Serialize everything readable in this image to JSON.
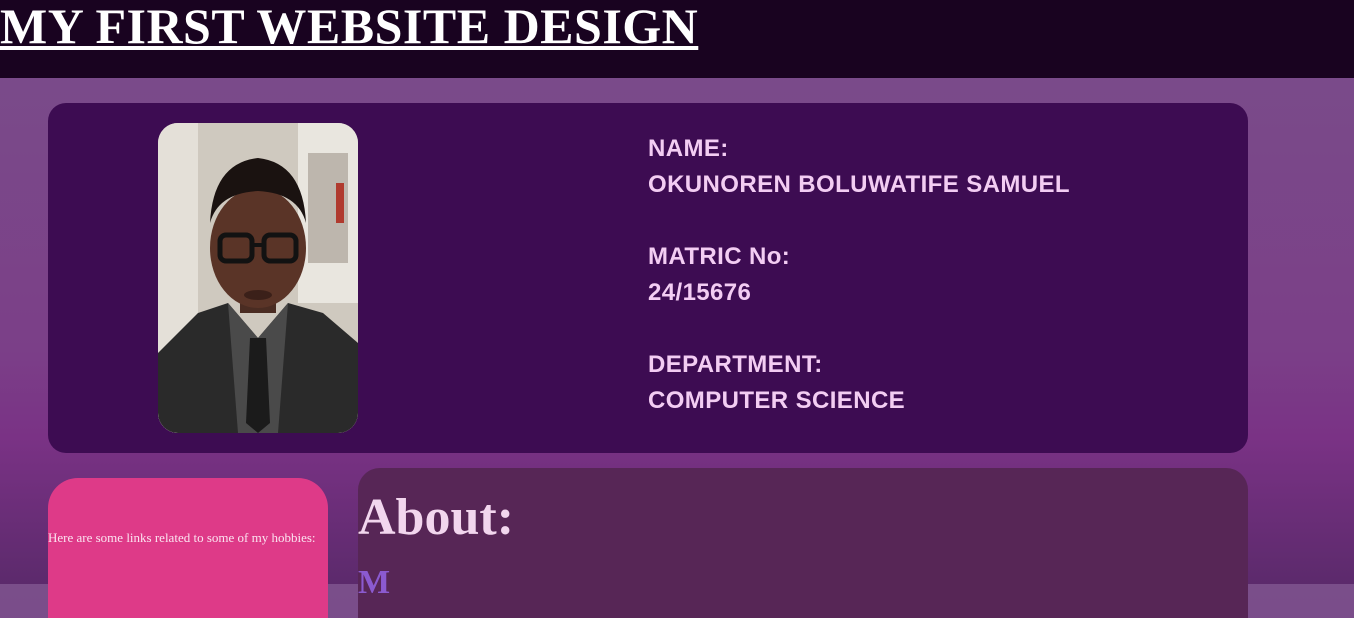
{
  "header": {
    "title": "MY FIRST WEBSITE DESIGN"
  },
  "profile": {
    "photo_icon": "portrait-photo",
    "name_label": "NAME:",
    "name_value": "OKUNOREN BOLUWATIFE SAMUEL",
    "matric_label": "MATRIC No:",
    "matric_value": "24/15676",
    "department_label": "DEPARTMENT:",
    "department_value": "COMPUTER SCIENCE"
  },
  "hobbies": {
    "intro": "Here are some links related to some of my hobbies:"
  },
  "about": {
    "title": "About:",
    "dropcap": "M"
  },
  "colors": {
    "topbar": "#190320",
    "card": "#3d0c52",
    "info_text": "#f3cdf3",
    "links_box": "#de3a88",
    "about_box": "#572656"
  }
}
